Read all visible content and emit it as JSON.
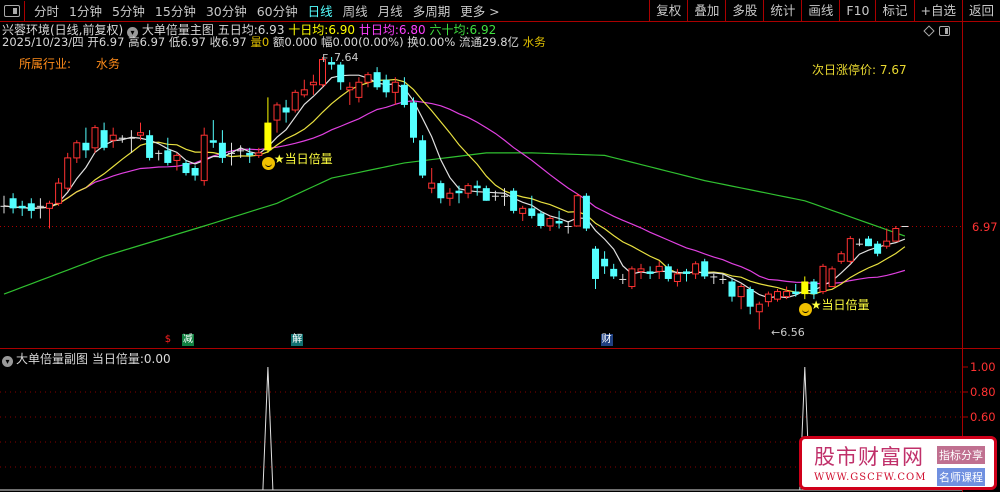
{
  "toolbar": {
    "periods": [
      "分时",
      "1分钟",
      "5分钟",
      "15分钟",
      "30分钟",
      "60分钟",
      "日线",
      "周线",
      "月线",
      "多周期",
      "更多 >"
    ],
    "active_period": "日线",
    "buttons": [
      "复权",
      "叠加",
      "多股",
      "统计",
      "画线",
      "F10",
      "标记",
      "+自选",
      "返回"
    ]
  },
  "header": {
    "stock": "兴蓉环境(日线,前复权)",
    "indicator": "大单倍量主图",
    "ma5_label": "五日均:",
    "ma5": "6.93",
    "ma10_label": "十日均:",
    "ma10": "6.90",
    "ma20_label": "廿日均:",
    "ma20": "6.80",
    "ma60_label": "六十均:",
    "ma60": "6.92",
    "date": "2025/10/23/四",
    "open_label": "开",
    "open": "6.97",
    "high_label": "高",
    "high": "6.97",
    "low_label": "低",
    "low": "6.97",
    "close_label": "收",
    "close": "6.97",
    "vol_label": "量",
    "vol": "0",
    "amount_label": "额",
    "amount": "0.000",
    "change_label": "幅",
    "change": "0.00(0.00%)",
    "turnover_label": "换",
    "turnover": "0.00%",
    "float_label": "流通",
    "float": "29.8亿",
    "sector": "水务"
  },
  "industry": {
    "label": "所属行业:",
    "value": "水务"
  },
  "limit_price": {
    "label": "次日涨停价:",
    "value": "7.67"
  },
  "price_axis": {
    "current": "6.97"
  },
  "annotations": {
    "high": "7.64",
    "low": "←6.56",
    "high_prefix": "F"
  },
  "signal_label": "★当日倍量",
  "bottom_markers": [
    {
      "text": "$",
      "color": "#ff2020",
      "bg": "transparent",
      "index": 18
    },
    {
      "text": "减",
      "color": "#ffffff",
      "bg": "#108040",
      "index": 20
    },
    {
      "text": "解",
      "color": "#ffffff",
      "bg": "#107070",
      "index": 32
    },
    {
      "text": "财",
      "color": "#ffffff",
      "bg": "#204080",
      "index": 66
    }
  ],
  "sub": {
    "title": "大单倍量副图",
    "value_label": "当日倍量:",
    "value": "0.00",
    "ticks": [
      "1.00",
      "0.80",
      "0.60"
    ]
  },
  "watermark": {
    "name": "股市财富网",
    "url": "WWW.GSCFW.COM",
    "tag1": "指标分享",
    "tag2": "名师课程"
  },
  "colors": {
    "up": "#ff3232",
    "down": "#54ffff",
    "ma5": "#e0e0e0",
    "ma10": "#e8e040",
    "ma20": "#e040e0",
    "ma60": "#30c030",
    "signal": "#ffff00"
  },
  "chart_data": {
    "type": "candlestick",
    "signal_indices": [
      29,
      88
    ],
    "candles": [
      [
        7.05,
        7.09,
        7.02,
        7.05
      ],
      [
        7.08,
        7.1,
        7.02,
        7.04
      ],
      [
        7.05,
        7.07,
        7.01,
        7.04
      ],
      [
        7.06,
        7.08,
        7.0,
        7.03
      ],
      [
        7.05,
        7.08,
        7.0,
        7.05
      ],
      [
        7.04,
        7.07,
        6.96,
        7.06
      ],
      [
        7.06,
        7.16,
        7.05,
        7.14
      ],
      [
        7.12,
        7.26,
        7.11,
        7.24
      ],
      [
        7.24,
        7.31,
        7.22,
        7.3
      ],
      [
        7.3,
        7.36,
        7.24,
        7.27
      ],
      [
        7.28,
        7.37,
        7.26,
        7.36
      ],
      [
        7.35,
        7.38,
        7.27,
        7.28
      ],
      [
        7.31,
        7.36,
        7.28,
        7.33
      ],
      [
        7.32,
        7.33,
        7.3,
        7.32
      ],
      [
        7.32,
        7.35,
        7.26,
        7.32
      ],
      [
        7.33,
        7.38,
        7.31,
        7.34
      ],
      [
        7.33,
        7.35,
        7.23,
        7.24
      ],
      [
        7.26,
        7.27,
        7.23,
        7.26
      ],
      [
        7.27,
        7.32,
        7.21,
        7.22
      ],
      [
        7.23,
        7.26,
        7.19,
        7.25
      ],
      [
        7.22,
        7.23,
        7.17,
        7.18
      ],
      [
        7.2,
        7.21,
        7.15,
        7.17
      ],
      [
        7.15,
        7.36,
        7.13,
        7.33
      ],
      [
        7.31,
        7.39,
        7.28,
        7.3
      ],
      [
        7.3,
        7.35,
        7.22,
        7.24
      ],
      [
        7.26,
        7.3,
        7.21,
        7.26
      ],
      [
        7.27,
        7.29,
        7.24,
        7.27
      ],
      [
        7.26,
        7.28,
        7.22,
        7.25
      ],
      [
        7.25,
        7.28,
        7.24,
        7.26
      ],
      [
        7.27,
        7.48,
        7.26,
        7.38
      ],
      [
        7.39,
        7.46,
        7.34,
        7.45
      ],
      [
        7.44,
        7.47,
        7.38,
        7.42
      ],
      [
        7.43,
        7.51,
        7.42,
        7.5
      ],
      [
        7.49,
        7.55,
        7.48,
        7.51
      ],
      [
        7.53,
        7.57,
        7.49,
        7.54
      ],
      [
        7.53,
        7.64,
        7.52,
        7.63
      ],
      [
        7.62,
        7.64,
        7.59,
        7.61
      ],
      [
        7.61,
        7.62,
        7.51,
        7.54
      ],
      [
        7.51,
        7.54,
        7.45,
        7.52
      ],
      [
        7.48,
        7.56,
        7.46,
        7.54
      ],
      [
        7.54,
        7.58,
        7.52,
        7.57
      ],
      [
        7.58,
        7.6,
        7.51,
        7.52
      ],
      [
        7.55,
        7.57,
        7.48,
        7.5
      ],
      [
        7.5,
        7.56,
        7.45,
        7.54
      ],
      [
        7.53,
        7.56,
        7.44,
        7.45
      ],
      [
        7.46,
        7.48,
        7.3,
        7.32
      ],
      [
        7.31,
        7.33,
        7.16,
        7.17
      ],
      [
        7.12,
        7.2,
        7.1,
        7.14
      ],
      [
        7.14,
        7.15,
        7.06,
        7.08
      ],
      [
        7.08,
        7.12,
        7.05,
        7.1
      ],
      [
        7.11,
        7.13,
        7.06,
        7.1
      ],
      [
        7.1,
        7.14,
        7.08,
        7.13
      ],
      [
        7.13,
        7.15,
        7.09,
        7.12
      ],
      [
        7.12,
        7.13,
        7.07,
        7.07
      ],
      [
        7.09,
        7.11,
        7.07,
        7.09
      ],
      [
        7.09,
        7.12,
        7.05,
        7.09
      ],
      [
        7.11,
        7.12,
        7.02,
        7.03
      ],
      [
        7.02,
        7.05,
        6.99,
        7.04
      ],
      [
        7.04,
        7.09,
        7.0,
        7.01
      ],
      [
        7.02,
        7.03,
        6.96,
        6.97
      ],
      [
        6.97,
        7.01,
        6.95,
        7.0
      ],
      [
        6.99,
        7.03,
        6.96,
        6.98
      ],
      [
        6.97,
        6.99,
        6.94,
        6.97
      ],
      [
        6.97,
        7.1,
        6.97,
        7.09
      ],
      [
        7.09,
        7.1,
        6.95,
        6.96
      ],
      [
        6.88,
        6.89,
        6.72,
        6.76
      ],
      [
        6.84,
        6.87,
        6.78,
        6.81
      ],
      [
        6.8,
        6.82,
        6.76,
        6.77
      ],
      [
        6.76,
        6.78,
        6.74,
        6.76
      ],
      [
        6.73,
        6.81,
        6.72,
        6.8
      ],
      [
        6.79,
        6.82,
        6.76,
        6.8
      ],
      [
        6.79,
        6.81,
        6.76,
        6.78
      ],
      [
        6.79,
        6.83,
        6.76,
        6.81
      ],
      [
        6.81,
        6.82,
        6.75,
        6.76
      ],
      [
        6.75,
        6.8,
        6.73,
        6.78
      ],
      [
        6.79,
        6.8,
        6.75,
        6.78
      ],
      [
        6.78,
        6.83,
        6.76,
        6.82
      ],
      [
        6.83,
        6.84,
        6.76,
        6.77
      ],
      [
        6.77,
        6.78,
        6.74,
        6.77
      ],
      [
        6.76,
        6.78,
        6.74,
        6.76
      ],
      [
        6.75,
        6.76,
        6.67,
        6.69
      ],
      [
        6.69,
        6.74,
        6.64,
        6.73
      ],
      [
        6.72,
        6.73,
        6.62,
        6.65
      ],
      [
        6.63,
        6.67,
        6.56,
        6.66
      ],
      [
        6.67,
        6.71,
        6.65,
        6.7
      ],
      [
        6.68,
        6.72,
        6.67,
        6.71
      ],
      [
        6.69,
        6.73,
        6.68,
        6.71
      ],
      [
        6.71,
        6.74,
        6.69,
        6.7
      ],
      [
        6.7,
        6.77,
        6.68,
        6.75
      ],
      [
        6.75,
        6.76,
        6.68,
        6.7
      ],
      [
        6.71,
        6.82,
        6.7,
        6.81
      ],
      [
        6.73,
        6.81,
        6.73,
        6.8
      ],
      [
        6.83,
        6.87,
        6.82,
        6.86
      ],
      [
        6.83,
        6.93,
        6.82,
        6.92
      ],
      [
        6.9,
        6.92,
        6.89,
        6.9
      ],
      [
        6.92,
        6.93,
        6.89,
        6.89
      ],
      [
        6.9,
        6.91,
        6.85,
        6.86
      ],
      [
        6.89,
        6.96,
        6.88,
        6.91
      ],
      [
        6.91,
        6.97,
        6.91,
        6.96
      ],
      [
        6.97,
        6.97,
        6.97,
        6.97
      ]
    ],
    "ma60_samples": [
      [
        0,
        6.7
      ],
      [
        11,
        6.85
      ],
      [
        22,
        6.97
      ],
      [
        30,
        7.06
      ],
      [
        36,
        7.16
      ],
      [
        44,
        7.22
      ],
      [
        53,
        7.26
      ],
      [
        58,
        7.26
      ],
      [
        66,
        7.25
      ],
      [
        77,
        7.15
      ],
      [
        88,
        7.07
      ],
      [
        99,
        6.93
      ]
    ],
    "sub_values_at_signals": [
      1.0,
      1.0
    ],
    "ylim": [
      6.56,
      7.64
    ]
  }
}
